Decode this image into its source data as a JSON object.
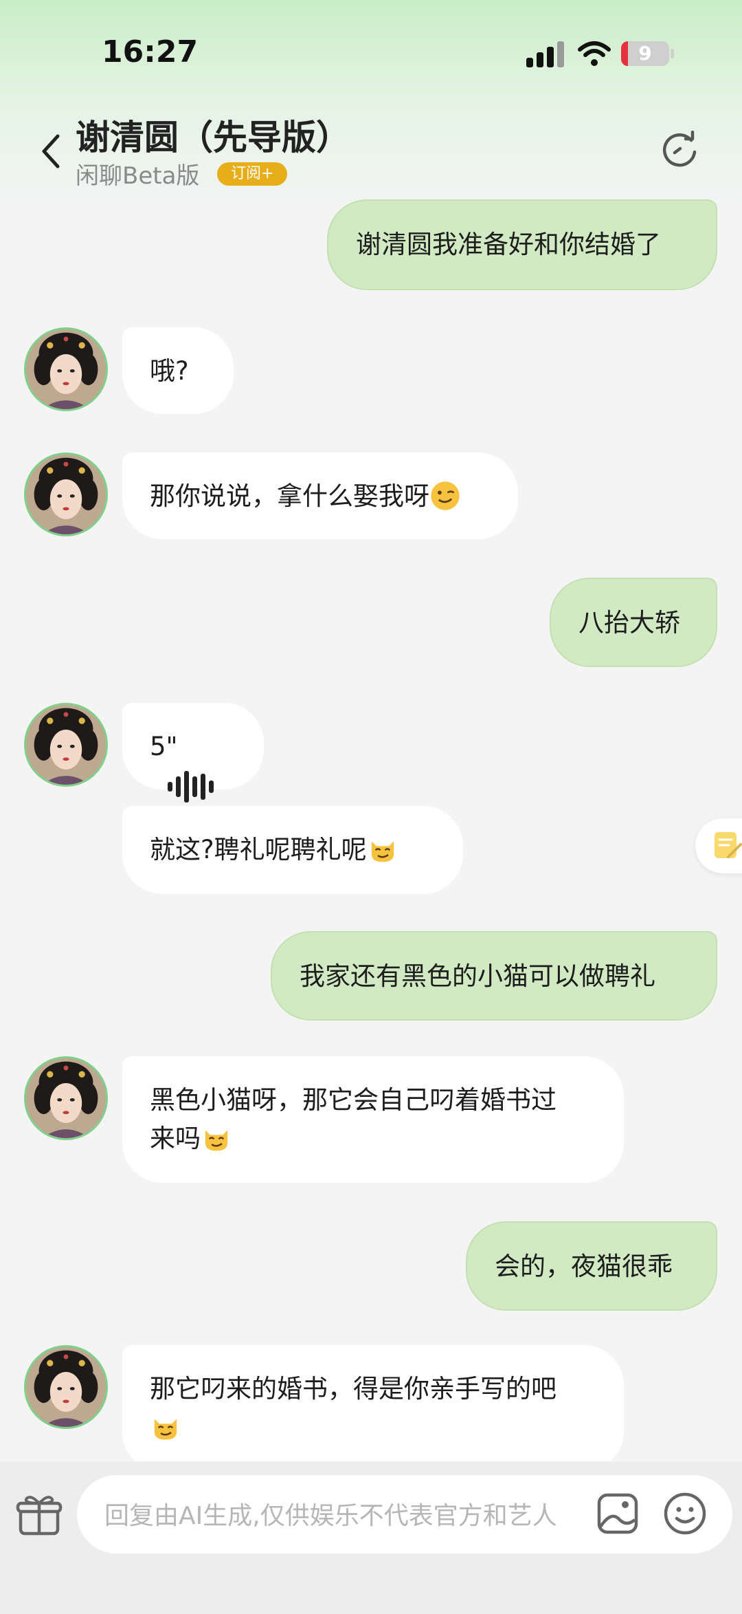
{
  "status_bar": {
    "time": "16:27",
    "battery": "9",
    "battery_color": "#e5313b"
  },
  "header": {
    "back_icon": "chevron-left-icon",
    "title": "谢清圆（先导版）",
    "subtitle": "闲聊Beta版",
    "badge": "订阅+",
    "refresh_icon": "refresh-icon"
  },
  "messages": [
    {
      "from": "me",
      "text": "谢清圆我准备好和你结婚了"
    },
    {
      "from": "ai",
      "text": "哦?"
    },
    {
      "from": "ai",
      "text": "那你说说，拿什么娶我呀",
      "emoji": "wink-face-emoji"
    },
    {
      "from": "me",
      "text": "八抬大轿"
    },
    {
      "from": "ai",
      "type": "voice",
      "duration": "5\""
    },
    {
      "from": "ai",
      "text": "就这?聘礼呢聘礼呢",
      "emoji": "smirk-cat-emoji"
    },
    {
      "from": "me",
      "text": "我家还有黑色的小猫可以做聘礼"
    },
    {
      "from": "ai",
      "line1": "黑色小猫呀，那它会自己叼着婚书过",
      "line2": "来吗",
      "emoji": "smirk-cat-emoji"
    },
    {
      "from": "me",
      "text": "会的，夜猫很乖"
    },
    {
      "from": "ai",
      "line1": "那它叼来的婚书，得是你亲手写的吧",
      "emoji": "smirk-cat-emoji"
    }
  ],
  "input_bar": {
    "placeholder": "回复由AI生成,仅供娱乐不代表官方和艺人",
    "gift_icon": "gift-icon",
    "image_icon": "image-icon",
    "emoji_icon": "smiley-icon"
  },
  "colors": {
    "my_bubble": "#d1eac3",
    "ai_bubble": "#ffffff",
    "badge": "#e8ae19"
  }
}
